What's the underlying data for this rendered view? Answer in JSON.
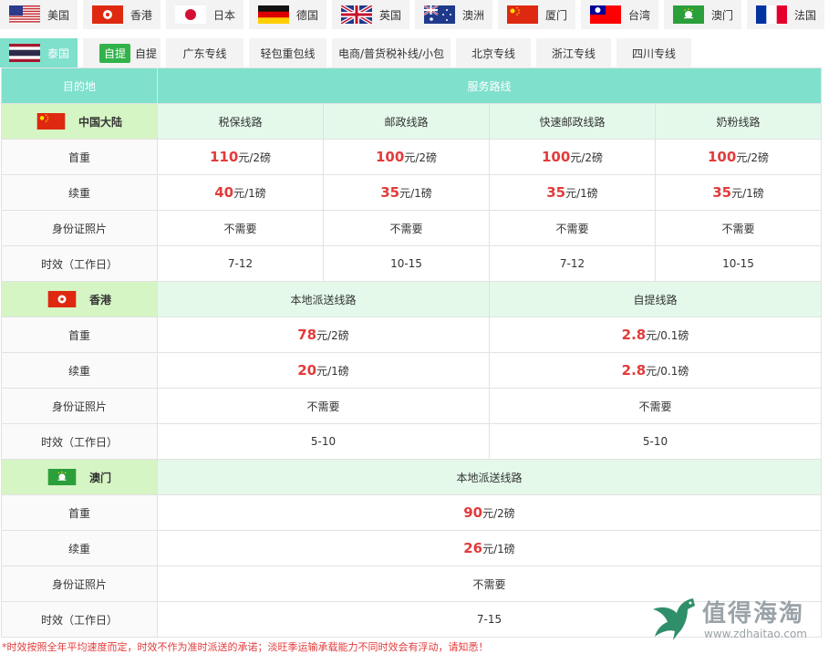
{
  "tabs_row1": [
    {
      "label": "美国",
      "flag": "us-flag-icon"
    },
    {
      "label": "香港",
      "flag": "hk-flag-icon"
    },
    {
      "label": "日本",
      "flag": "jp-flag-icon"
    },
    {
      "label": "德国",
      "flag": "de-flag-icon"
    },
    {
      "label": "英国",
      "flag": "uk-flag-icon"
    },
    {
      "label": "澳洲",
      "flag": "au-flag-icon"
    },
    {
      "label": "厦门",
      "flag": "cn-flag-icon"
    },
    {
      "label": "台湾",
      "flag": "tw-flag-icon"
    },
    {
      "label": "澳门",
      "flag": "mo-flag-icon"
    },
    {
      "label": "法国",
      "flag": "fr-flag-icon"
    }
  ],
  "tabs_row2": [
    {
      "label": "泰国",
      "flag": "th-flag-icon",
      "active": true
    },
    {
      "label": "自提",
      "badge": "自提"
    },
    {
      "label": "广东专线"
    },
    {
      "label": "轻包重包线"
    },
    {
      "label": "电商/普货税补线/小包"
    },
    {
      "label": "北京专线"
    },
    {
      "label": "浙江专线"
    },
    {
      "label": "四川专线"
    }
  ],
  "table": {
    "header": {
      "destination": "目的地",
      "routes": "服务路线"
    },
    "regions": [
      {
        "name": "中国大陆",
        "flag": "cn-flag-icon",
        "routes": [
          "税保线路",
          "邮政线路",
          "快速邮政线路",
          "奶粉线路"
        ],
        "rows": [
          {
            "label": "首重",
            "cells": [
              {
                "num": "110",
                "unit": "元/2磅"
              },
              {
                "num": "100",
                "unit": "元/2磅"
              },
              {
                "num": "100",
                "unit": "元/2磅"
              },
              {
                "num": "100",
                "unit": "元/2磅"
              }
            ]
          },
          {
            "label": "续重",
            "cells": [
              {
                "num": "40",
                "unit": "元/1磅"
              },
              {
                "num": "35",
                "unit": "元/1磅"
              },
              {
                "num": "35",
                "unit": "元/1磅"
              },
              {
                "num": "35",
                "unit": "元/1磅"
              }
            ]
          },
          {
            "label": "身份证照片",
            "cells": [
              {
                "text": "不需要"
              },
              {
                "text": "不需要"
              },
              {
                "text": "不需要"
              },
              {
                "text": "不需要"
              }
            ]
          },
          {
            "label": "时效（工作日）",
            "cells": [
              {
                "text": "7-12"
              },
              {
                "text": "10-15"
              },
              {
                "text": "7-12"
              },
              {
                "text": "10-15"
              }
            ]
          }
        ]
      },
      {
        "name": "香港",
        "flag": "hk-flag-icon",
        "routes": [
          "本地派送线路",
          "自提线路"
        ],
        "rows": [
          {
            "label": "首重",
            "cells": [
              {
                "num": "78",
                "unit": "元/2磅"
              },
              {
                "num": "2.8",
                "unit": "元/0.1磅"
              }
            ]
          },
          {
            "label": "续重",
            "cells": [
              {
                "num": "20",
                "unit": "元/1磅"
              },
              {
                "num": "2.8",
                "unit": "元/0.1磅"
              }
            ]
          },
          {
            "label": "身份证照片",
            "cells": [
              {
                "text": "不需要"
              },
              {
                "text": "不需要"
              }
            ]
          },
          {
            "label": "时效（工作日）",
            "cells": [
              {
                "text": "5-10"
              },
              {
                "text": "5-10"
              }
            ]
          }
        ]
      },
      {
        "name": "澳门",
        "flag": "mo-flag-icon",
        "routes": [
          "本地派送线路"
        ],
        "rows": [
          {
            "label": "首重",
            "cells": [
              {
                "num": "90",
                "unit": "元/2磅"
              }
            ]
          },
          {
            "label": "续重",
            "cells": [
              {
                "num": "26",
                "unit": "元/1磅"
              }
            ]
          },
          {
            "label": "身份证照片",
            "cells": [
              {
                "text": "不需要"
              }
            ]
          },
          {
            "label": "时效（工作日）",
            "cells": [
              {
                "text": "7-15"
              }
            ]
          }
        ]
      }
    ]
  },
  "footnote": "*时效按照全年平均速度而定，时效不作为准时派送的承诺；淡旺季运输承载能力不同时效会有浮动，请知悉！",
  "watermark": {
    "title": "值得海淘",
    "url": "www.zdhaitao.com"
  },
  "colors": {
    "accent": "#7fe0cc",
    "price": "#e23b3b",
    "region_bg": "#e4f9ea",
    "region_label_bg": "#d6f5c4",
    "badge": "#31b34a"
  }
}
